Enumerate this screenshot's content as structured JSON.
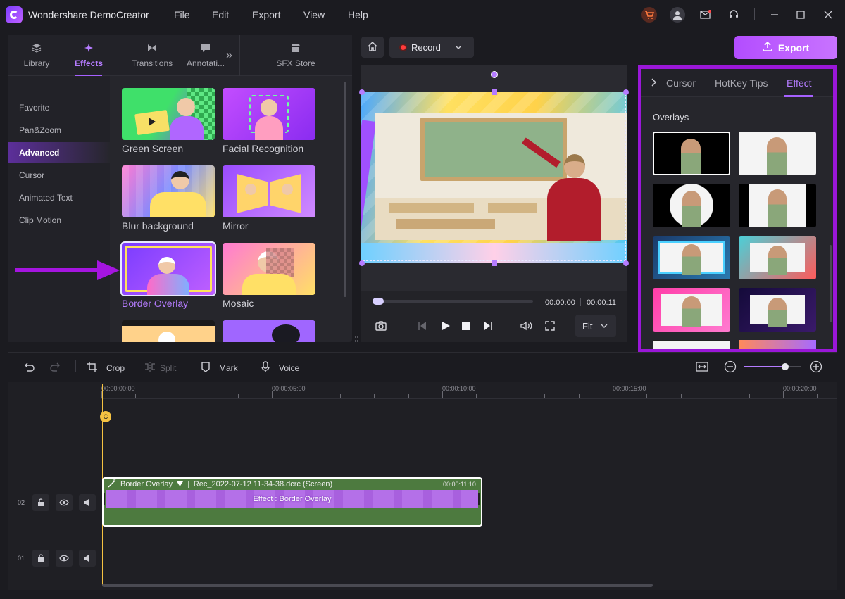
{
  "app": {
    "title": "Wondershare DemoCreator",
    "menu": [
      "File",
      "Edit",
      "Export",
      "View",
      "Help"
    ]
  },
  "left_tabs": [
    {
      "label": "Library",
      "icon": "layers-icon"
    },
    {
      "label": "Effects",
      "icon": "sparkle-icon",
      "active": true
    },
    {
      "label": "Transitions",
      "icon": "transition-icon"
    },
    {
      "label": "Annotati...",
      "icon": "annotation-icon"
    },
    {
      "label": "SFX Store",
      "icon": "store-icon"
    }
  ],
  "categories": [
    {
      "label": "Favorite"
    },
    {
      "label": "Pan&Zoom"
    },
    {
      "label": "Advanced",
      "active": true
    },
    {
      "label": "Cursor"
    },
    {
      "label": "Animated Text"
    },
    {
      "label": "Clip Motion"
    }
  ],
  "effects": [
    {
      "label": "Green Screen"
    },
    {
      "label": "Facial Recognition"
    },
    {
      "label": "Blur background"
    },
    {
      "label": "Mirror"
    },
    {
      "label": "Border Overlay",
      "selected": true
    },
    {
      "label": "Mosaic"
    }
  ],
  "toolbar": {
    "record_label": "Record",
    "export_label": "Export"
  },
  "player": {
    "current_time": "00:00:00",
    "total_time": "00:00:11",
    "fit_label": "Fit",
    "progress": 0
  },
  "right_tabs": [
    {
      "label": "Cursor"
    },
    {
      "label": "HotKey Tips"
    },
    {
      "label": "Effect",
      "active": true
    }
  ],
  "overlays_title": "Overlays",
  "timeline_tools": {
    "crop": "Crop",
    "split": "Split",
    "mark": "Mark",
    "voice": "Voice"
  },
  "ruler": [
    "00:00:00:00",
    "00:00:05:00",
    "00:00:10:00",
    "00:00:15:00",
    "00:00:20:00"
  ],
  "tracks": [
    {
      "num": "02"
    },
    {
      "num": "01"
    }
  ],
  "clip": {
    "effect_name": "Border Overlay",
    "file_name": "Rec_2022-07-12 11-34-38.dcrc (Screen)",
    "duration": "00:00:11:10",
    "strip_label": "Effect : Border Overlay"
  },
  "zoom_level": 0.72,
  "colors": {
    "accent": "#a661ff",
    "highlight_border": "#9a17d8",
    "playhead": "#f5c242",
    "clip_green": "#4d7a3f"
  }
}
